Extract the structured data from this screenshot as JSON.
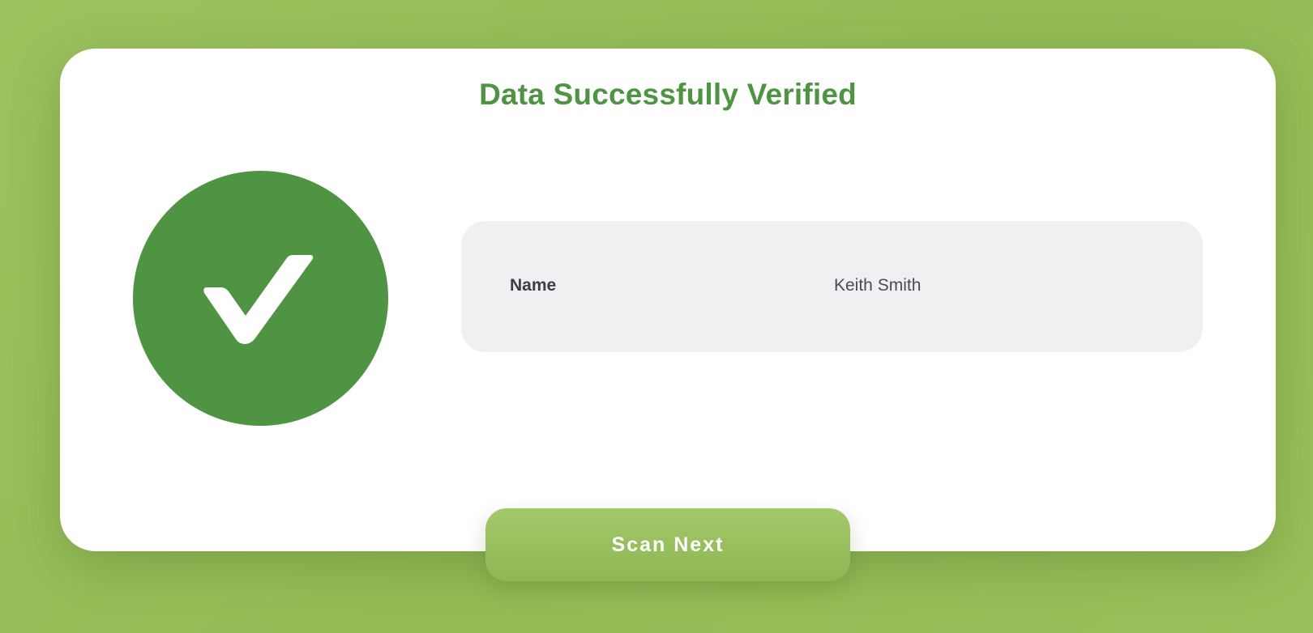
{
  "header": {
    "title": "Data Successfully Verified"
  },
  "status": {
    "icon": "checkmark-icon",
    "color": "#4e9442"
  },
  "details": {
    "fields": [
      {
        "label": "Name",
        "value": "Keith Smith"
      }
    ]
  },
  "actions": {
    "scan_next_label": "Scan Next"
  },
  "colors": {
    "background": "#96be59",
    "accent": "#4e9442",
    "panel": "#eff0f2",
    "button": "#98bf5e"
  }
}
